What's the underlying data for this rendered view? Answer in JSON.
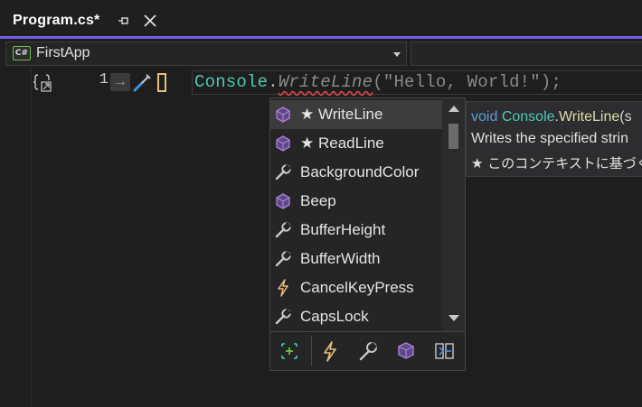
{
  "tab": {
    "title": "Program.cs*",
    "pin_icon": "pin-icon",
    "close_icon": "close-icon"
  },
  "navbar": {
    "project": "FirstApp",
    "badge": "C#"
  },
  "editor": {
    "line_number": "1",
    "arrow": "→",
    "code": {
      "class": "Console",
      "dot": ".",
      "method": "WriteLine",
      "args": "(\"Hello, World!\");"
    }
  },
  "completion": {
    "items": [
      {
        "label": "★ WriteLine",
        "icon": "method-cube-icon",
        "selected": true
      },
      {
        "label": "★ ReadLine",
        "icon": "method-cube-icon",
        "selected": false
      },
      {
        "label": "BackgroundColor",
        "icon": "wrench-icon",
        "selected": false
      },
      {
        "label": "Beep",
        "icon": "method-cube-icon",
        "selected": false
      },
      {
        "label": "BufferHeight",
        "icon": "wrench-icon",
        "selected": false
      },
      {
        "label": "BufferWidth",
        "icon": "wrench-icon",
        "selected": false
      },
      {
        "label": "CancelKeyPress",
        "icon": "lightning-icon",
        "selected": false
      },
      {
        "label": "CapsLock",
        "icon": "wrench-icon",
        "selected": false
      }
    ],
    "filters": [
      "snippets-icon",
      "events-icon",
      "properties-icon",
      "methods-icon",
      "extension-methods-icon"
    ]
  },
  "tooltip": {
    "keyword": "void",
    "class": "Console",
    "dot": ".",
    "method": "WriteLine",
    "rest": "(s",
    "description": "Writes the specified strin",
    "note": "★  このコンテキストに基づく"
  },
  "colors": {
    "accent": "#7160e8",
    "class": "#4ec9b0",
    "keyword": "#569cd6",
    "method": "#dcdcaa",
    "squiggle": "#cc4444"
  }
}
